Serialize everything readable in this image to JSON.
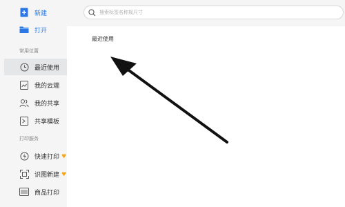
{
  "sidebar": {
    "new_label": "新建",
    "open_label": "打开",
    "section_common": "常用位置",
    "items": [
      {
        "label": "最近使用"
      },
      {
        "label": "我的云端"
      },
      {
        "label": "我的共享"
      },
      {
        "label": "共享模板"
      }
    ],
    "section_print": "打印服务",
    "print_items": [
      {
        "label": "快速打印"
      },
      {
        "label": "识图新建"
      },
      {
        "label": "商品打印"
      }
    ]
  },
  "search": {
    "placeholder": "搜索标签名称规尺寸"
  },
  "main": {
    "title": "最近使用"
  },
  "colors": {
    "accent": "#2b78e4",
    "vip": "#f3a81c",
    "sidebar_bg": "#f5f5f6"
  }
}
